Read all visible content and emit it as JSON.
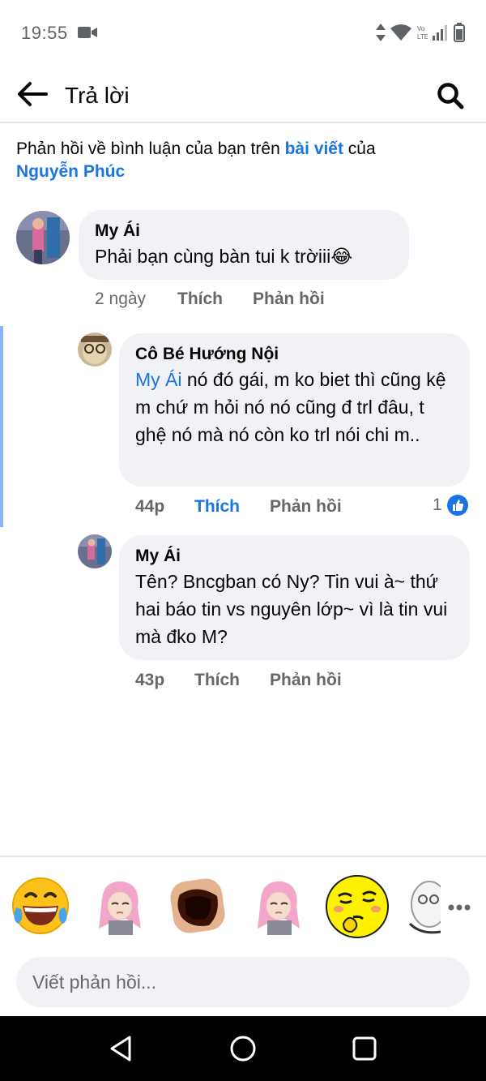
{
  "status_bar": {
    "time": "19:55",
    "icons": [
      "camera-icon",
      "data-arrows-icon",
      "wifi-icon",
      "volte-icon",
      "signal-icon",
      "battery-icon"
    ]
  },
  "header": {
    "title": "Trả lời",
    "back_icon": "arrow-left-icon",
    "search_icon": "search-icon"
  },
  "context": {
    "prefix": "Phản hồi về bình luận của bạn trên ",
    "post_link": "bài viết",
    "middle": " của",
    "author_link": "Nguyễn Phúc"
  },
  "comments": [
    {
      "author": "My Ái",
      "text": "Phải bạn cùng bàn tui k trờiii😂",
      "time": "2 ngày",
      "like_label": "Thích",
      "reply_label": "Phản hồi"
    },
    {
      "author": "Cô Bé Hướng Nội",
      "mention": "My Ái",
      "text": " nó đó gái, m ko biet thì cũng kệ m chứ m hỏi nó nó cũng đ trl đâu, t ghệ nó mà nó còn ko trl nói chi m..",
      "time": "44p",
      "like_label": "Thích",
      "liked": true,
      "reply_label": "Phản hồi",
      "reaction_count": "1"
    },
    {
      "author": "My Ái",
      "text": "Tên? Bncgban có Ny? Tin vui à~ thứ hai báo tin vs nguyên lớp~ vì là tin vui mà đko M?",
      "time": "43p",
      "like_label": "Thích",
      "reply_label": "Phản hồi"
    }
  ],
  "sticker_tray": {
    "stickers": [
      "laughing-tears-emoji",
      "pink-hair-girl-sticker",
      "screaming-mouth-sticker",
      "pink-hair-girl-sticker",
      "thinking-face-emoji",
      "partial-sticker"
    ],
    "more_icon": "more-horizontal-icon"
  },
  "reply_box": {
    "placeholder": "Viết phản hồi..."
  },
  "navigation": {
    "back": "nav-back-icon",
    "home": "nav-home-icon",
    "recents": "nav-recents-icon"
  },
  "colors": {
    "accent": "#1b74e4",
    "bubble": "#f0f2f5",
    "secondary_text": "#65676b",
    "highlight_bar": "#89b4f5"
  }
}
